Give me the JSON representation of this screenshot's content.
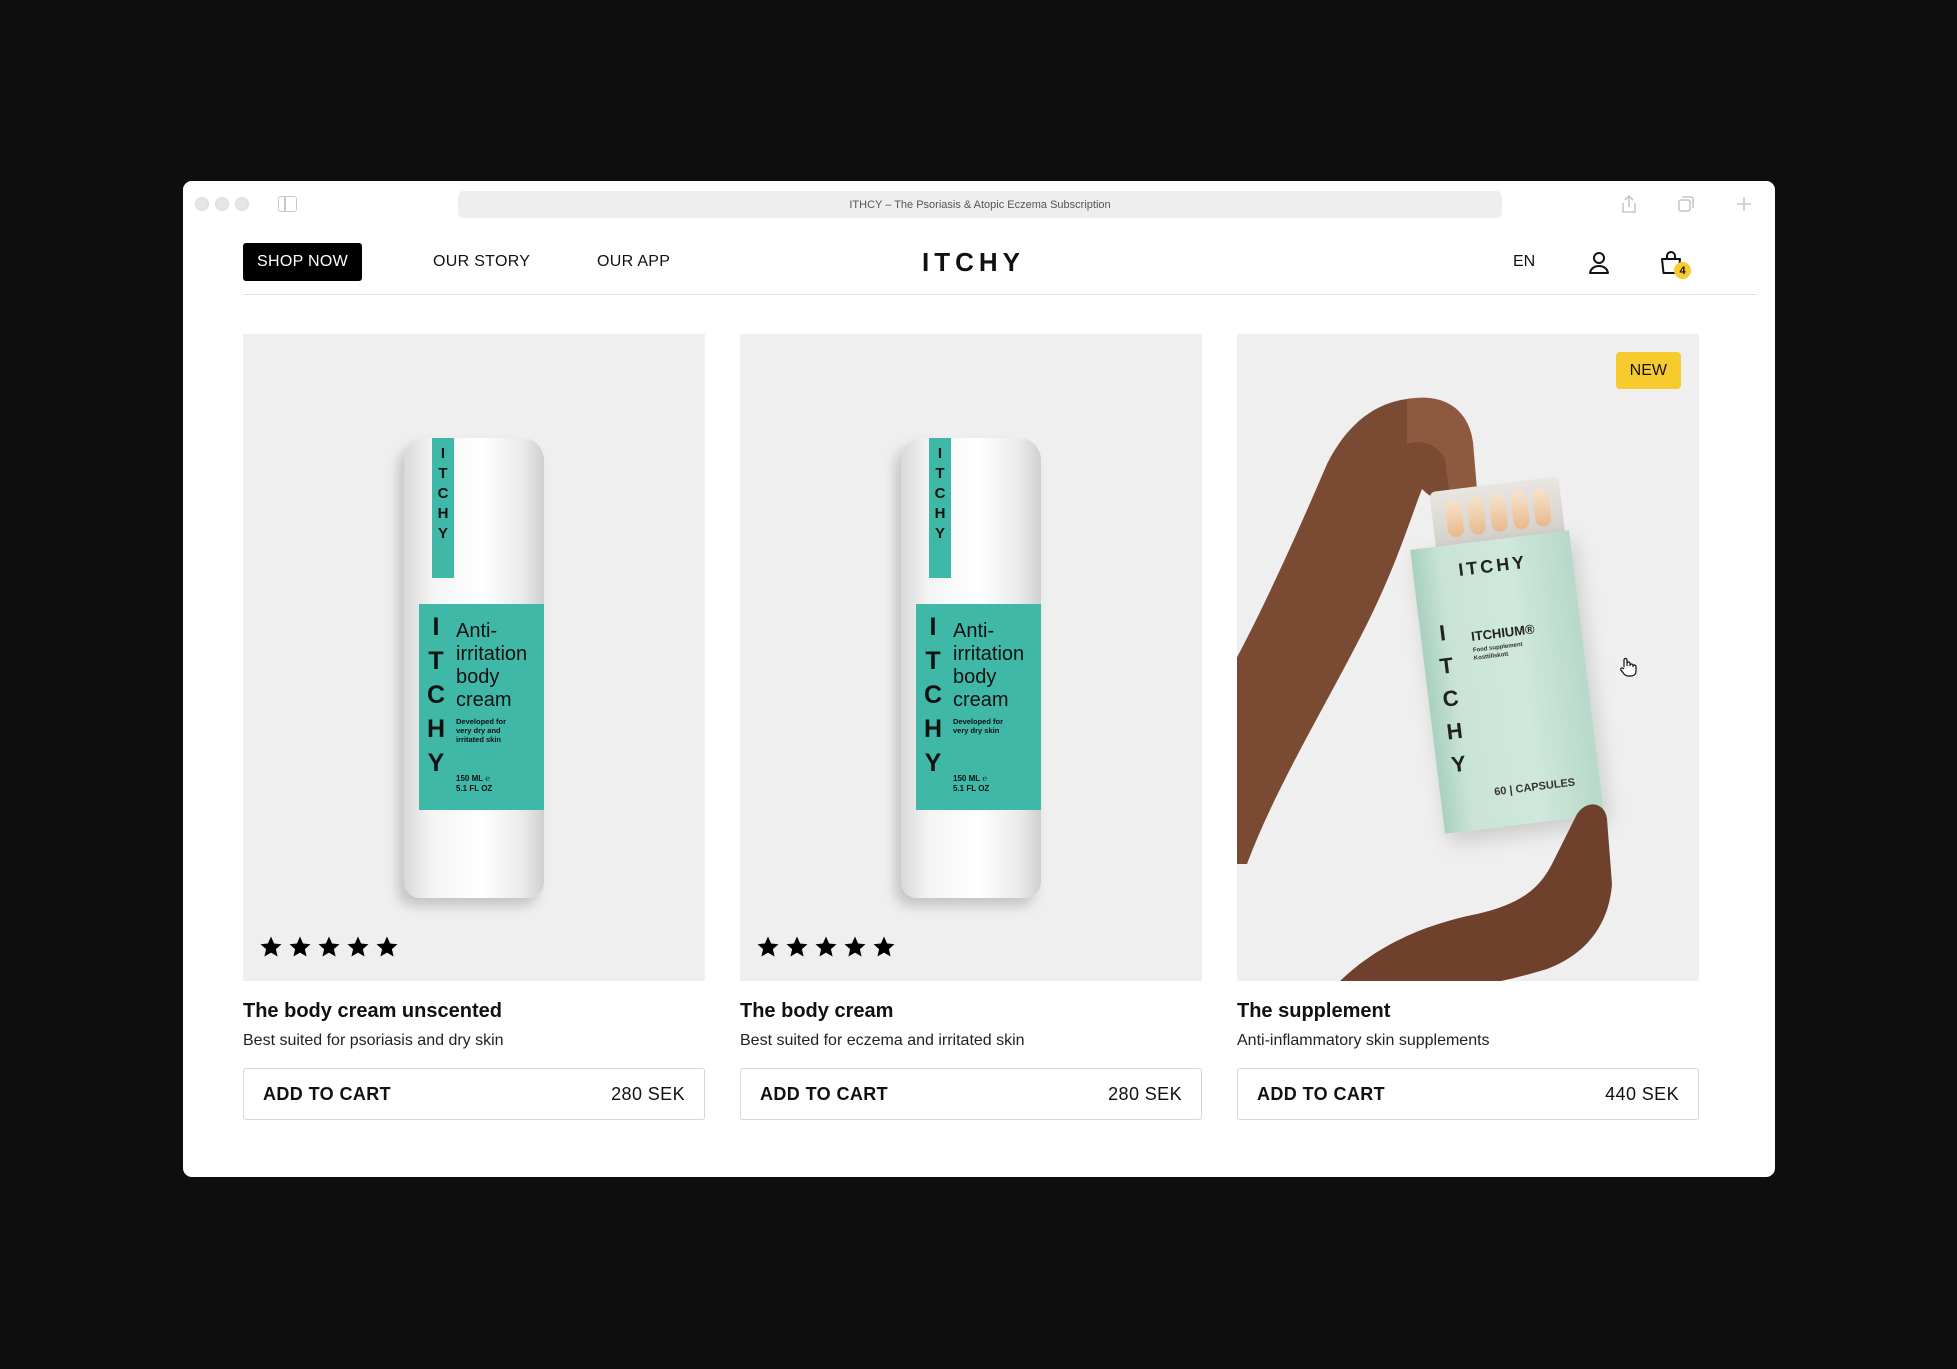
{
  "browser": {
    "address_title": "ITHCY – The Psoriasis & Atopic Eczema Subscription"
  },
  "header": {
    "shop_now": "SHOP NOW",
    "our_story": "OUR STORY",
    "our_app": "OUR APP",
    "logo": "ITCHY",
    "language": "EN",
    "cart_count": "4"
  },
  "products": [
    {
      "title": "The body cream unscented",
      "description": "Best suited for psoriasis and dry skin",
      "cta": "ADD TO CART",
      "price": "280 SEK",
      "rating": 5
    },
    {
      "title": "The body cream",
      "description": "Best suited for eczema and irritated skin",
      "cta": "ADD TO CART",
      "price": "280 SEK",
      "rating": 5
    },
    {
      "title": "The supplement",
      "description": "Anti-inflammatory skin supplements",
      "cta": "ADD TO CART",
      "price": "440 SEK",
      "badge": "NEW"
    }
  ],
  "packaging": {
    "tab_letters": [
      "I",
      "T",
      "C",
      "H",
      "Y"
    ],
    "cream_label_lines": [
      "Anti-",
      "irritation",
      "body",
      "cream"
    ],
    "cream_unscented_note": [
      "Developed for",
      "very dry and",
      "irritated skin"
    ],
    "cream_note": [
      "Developed for",
      "very dry skin"
    ],
    "volume": [
      "150 ML ℮",
      "5.1 FL OZ"
    ],
    "supplement_brand": "ITCHY",
    "supplement_name": "ITCHIUM®",
    "supplement_sub": [
      "Food supplement",
      "Kosttillskott"
    ],
    "supplement_count": "60 | CAPSULES"
  },
  "colors": {
    "accent_yellow": "#f7cb2d",
    "label_teal": "#3fb8a8",
    "supplement_mint": "#c9e4d6",
    "card_bg": "#efefef"
  },
  "icons": [
    "sidebar-icon",
    "share-icon",
    "tabs-icon",
    "plus-icon",
    "account-icon",
    "shopping-bag-icon",
    "star-icon",
    "hand-cursor-icon"
  ]
}
